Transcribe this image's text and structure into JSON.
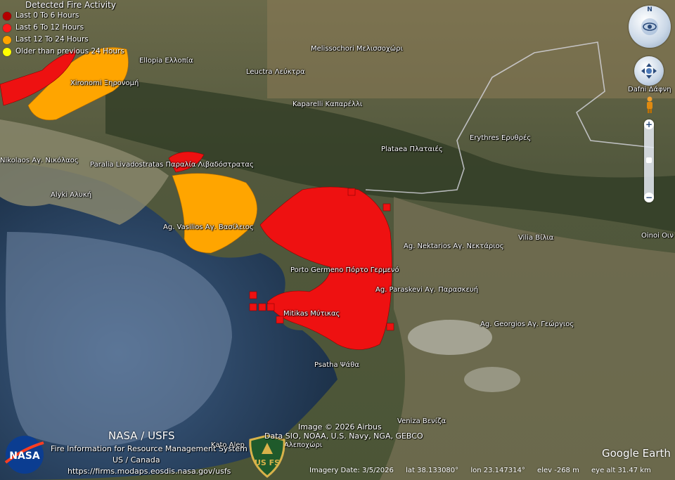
{
  "legend": {
    "title": "Detected Fire Activity",
    "items": [
      {
        "label": "Last 0 To 6 Hours",
        "color": "#b30000"
      },
      {
        "label": "Last 6 To 12 Hours",
        "color": "#ff1a1a"
      },
      {
        "label": "Last 12 To 24 Hours",
        "color": "#ffa500"
      },
      {
        "label": "Older than previous 24 Hours",
        "color": "#ffff00"
      }
    ]
  },
  "places": [
    {
      "name": "Ellopia Ελλοπία"
    },
    {
      "name": "Leuctra Λεύκτρα"
    },
    {
      "name": "Melissochori Μελισσοχώρι"
    },
    {
      "name": "Xironomi Ξηρονομή"
    },
    {
      "name": "Kaparelli Καπαρέλλι"
    },
    {
      "name": "Dafni Δάφνη"
    },
    {
      "name": "Erythres Ερυθρές"
    },
    {
      "name": "Plataea Πλαταιές"
    },
    {
      "name": "Nikolaos Αγ. Νικόλαος"
    },
    {
      "name": "Paralia Livadostratas Παραλία Λιβαδόστρατας"
    },
    {
      "name": "Alyki Αλυκή"
    },
    {
      "name": "Ag. Vasilios Αγ. Βασίλειος"
    },
    {
      "name": "Ag. Nektarios Αγ. Νεκτάριος"
    },
    {
      "name": "Vilia Βίλια"
    },
    {
      "name": "Oinoi Οιν"
    },
    {
      "name": "Porto Germeno Πόρτο Γερμενό"
    },
    {
      "name": "Ag. Paraskevi Αγ. Παρασκευή"
    },
    {
      "name": "Mitikas Μύτικας"
    },
    {
      "name": "Ag. Georgios Αγ. Γεώργιος"
    },
    {
      "name": "Psatha Ψάθα"
    },
    {
      "name": "Veniza Βενίζα"
    },
    {
      "name": "Kato Alep"
    },
    {
      "name": "Αλεποχώρι"
    }
  ],
  "credits": {
    "nasa_usfs": "NASA / USFS",
    "firms_system": "Fire Information for Resource Management System",
    "region": "US / Canada",
    "url": "https://firms.modaps.eosdis.nasa.gov/usfs",
    "nasa_logo": "NASA",
    "usfs_logo_letters": "US FS",
    "image_credit": "Image © 2026 Airbus",
    "data_credit": "Data SIO, NOAA, U.S. Navy, NGA, GEBCO",
    "google_earth": "Google Earth"
  },
  "status": {
    "imagery_date": "Imagery Date: 3/5/2026",
    "lat": "lat   38.133080°",
    "lon": "lon   23.147314°",
    "elev": "elev  -268 m",
    "eye_alt": "eye alt  31.47 km"
  },
  "controls": {
    "zoom_in": "+",
    "zoom_out": "−",
    "north": "N"
  }
}
